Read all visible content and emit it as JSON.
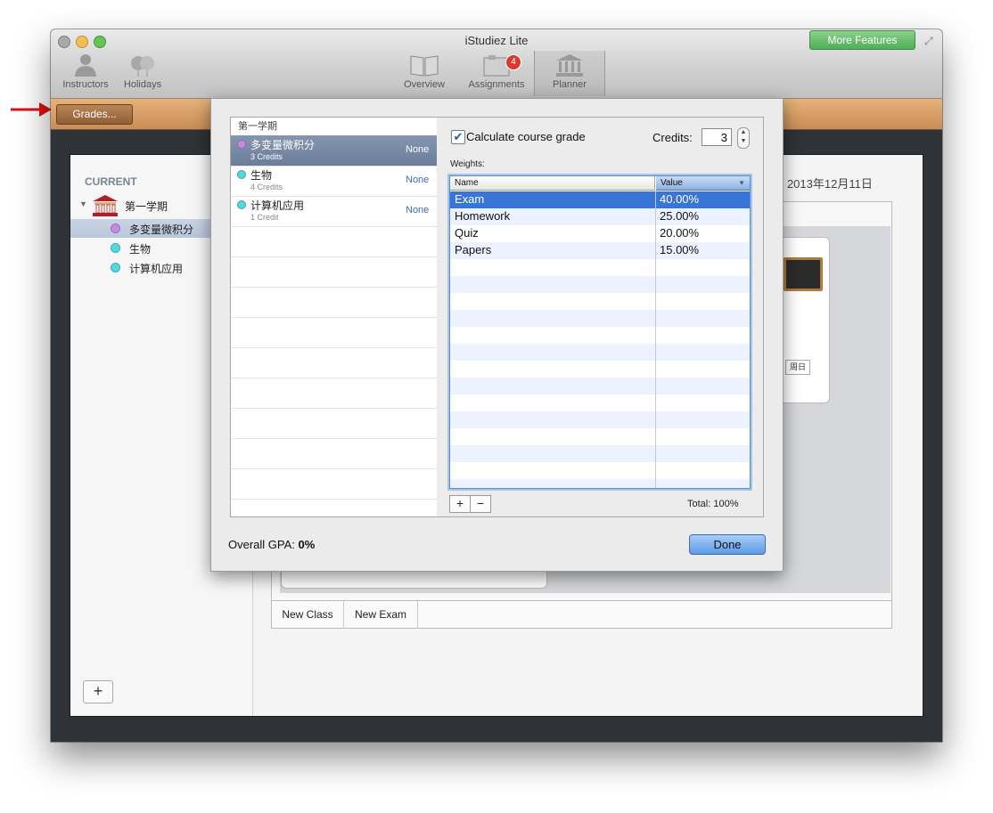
{
  "window": {
    "title": "iStudiez Lite",
    "more_features": "More Features"
  },
  "toolbar": {
    "instructors": "Instructors",
    "holidays": "Holidays",
    "overview": "Overview",
    "assignments": "Assignments",
    "assignments_badge": "4",
    "planner": "Planner"
  },
  "woodbar": {
    "grades_button": "Grades..."
  },
  "sidebar": {
    "current_label": "CURRENT",
    "term": "第一学期",
    "courses": [
      {
        "name": "多变量微积分",
        "color": "#c58be0"
      },
      {
        "name": "生物",
        "color": "#52d8df"
      },
      {
        "name": "计算机应用",
        "color": "#52d8df"
      }
    ],
    "add_label": "+"
  },
  "background": {
    "date_text": "- 2013年12月11日",
    "sunday_label": "周日",
    "tabs": [
      "New Class",
      "New Exam"
    ]
  },
  "grades_sheet": {
    "term_header": "第一学期",
    "courses": [
      {
        "name": "多变量微积分",
        "credits": "3 Credits",
        "grade": "None",
        "color": "#c58be0",
        "selected": true
      },
      {
        "name": "生物",
        "credits": "4 Credits",
        "grade": "None",
        "color": "#52d8df",
        "selected": false
      },
      {
        "name": "计算机应用",
        "credits": "1 Credit",
        "grade": "None",
        "color": "#52d8df",
        "selected": false
      }
    ],
    "calculate_label": "Calculate course grade",
    "calculate_checked": true,
    "credits_label": "Credits:",
    "credits_value": "3",
    "weights_label": "Weights:",
    "columns": {
      "name": "Name",
      "value": "Value"
    },
    "weights": [
      {
        "name": "Exam",
        "value": "40.00%",
        "selected": true
      },
      {
        "name": "Homework",
        "value": "25.00%",
        "selected": false
      },
      {
        "name": "Quiz",
        "value": "20.00%",
        "selected": false
      },
      {
        "name": "Papers",
        "value": "15.00%",
        "selected": false
      }
    ],
    "add_label": "+",
    "remove_label": "−",
    "total_label": "Total: 100%",
    "gpa_prefix": "Overall GPA: ",
    "gpa_value": "0%",
    "done_label": "Done"
  },
  "colors": {
    "selection": "#3875d7",
    "wood": "#d9a067",
    "annotation_arrow": "#e01010"
  }
}
